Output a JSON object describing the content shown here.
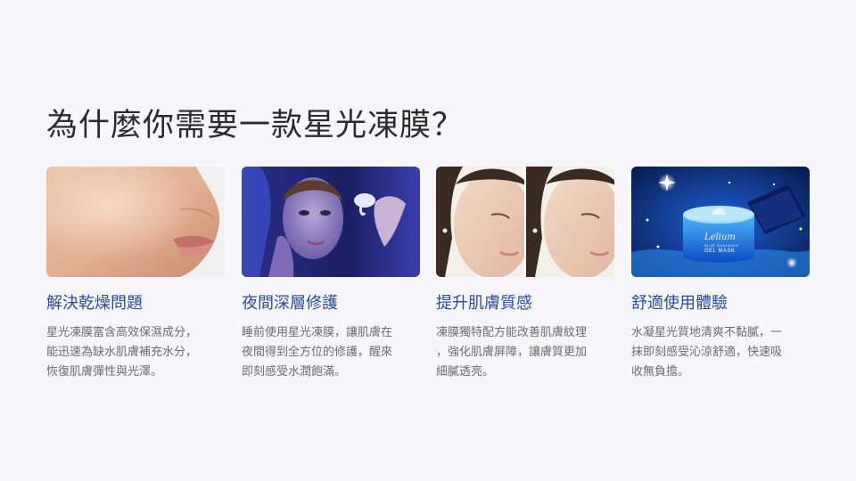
{
  "title": "為什麼你需要一款星光凍膜？",
  "cards": [
    {
      "heading": "解決乾燥問題",
      "lines": [
        "星光凍膜富含高效保濕成分，",
        "能迅速為缺水肌膚補充水分，",
        "恢復肌膚彈性與光澤。"
      ],
      "image_alt": "close-up of moisturized facial skin"
    },
    {
      "heading": "夜間深層修護",
      "lines": [
        "睡前使用星光凍膜，讓肌膚在",
        "夜間得到全方位的修護，醒來",
        "即刻感受水潤飽滿。"
      ],
      "image_alt": "woman applying glowing gel mask at night"
    },
    {
      "heading": "提升肌膚質感",
      "lines": [
        "凍膜獨特配方能改善肌膚紋理",
        "，強化肌膚屏障，讓膚質更加",
        "細膩透亮。"
      ],
      "image_alt": "before and after skin texture comparison"
    },
    {
      "heading": "舒適使用體驗",
      "lines": [
        "水凝星光質地清爽不黏膩，一",
        "抹即刻感受沁涼舒適，快速吸",
        "收無負擔。"
      ],
      "image_alt": "blue gel mask jar with starlight sparkles",
      "product_label": {
        "brand": "Lelium",
        "sub": "BLUE RADIANCE",
        "name": "GEL MASK"
      }
    }
  ]
}
